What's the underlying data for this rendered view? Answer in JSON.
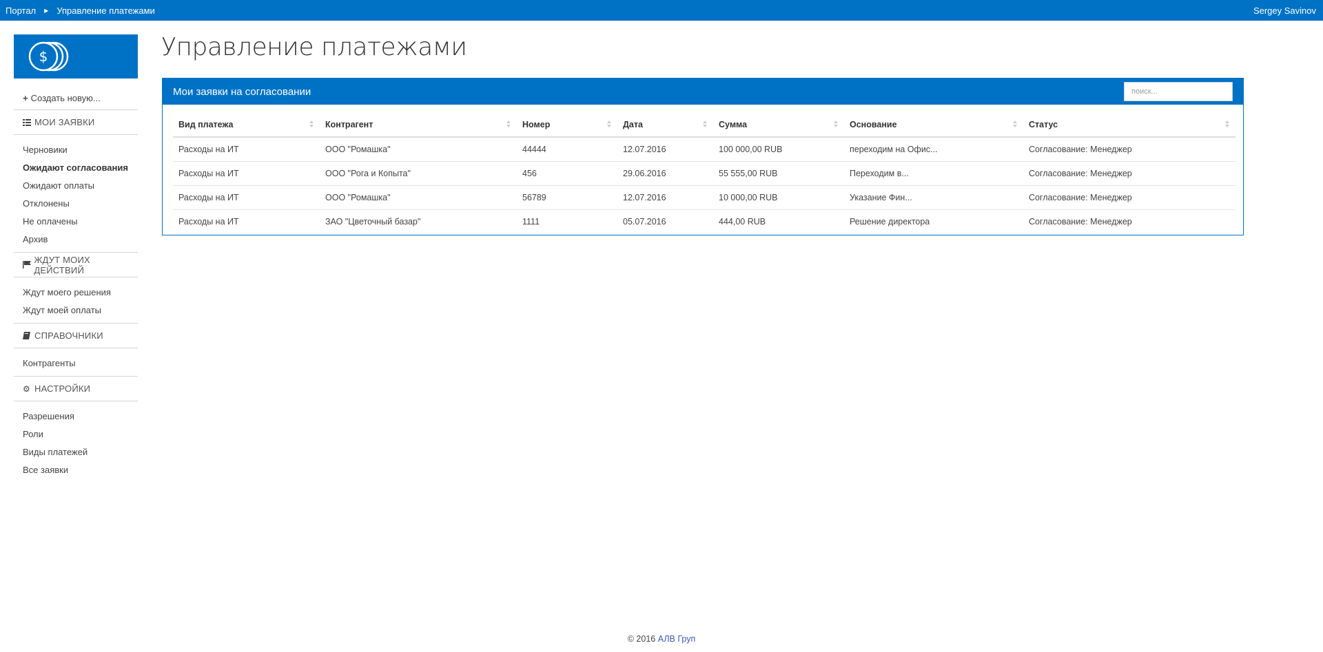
{
  "topbar": {
    "crumbs": [
      "Портал",
      "Управление платежами"
    ],
    "user": "Sergey Savinov"
  },
  "sidebar": {
    "create_label": "Создать новую...",
    "sections": [
      {
        "icon": "list-icon",
        "title": "МОИ ЗАЯВКИ",
        "items": [
          "Черновики",
          "Ожидают согласования",
          "Ожидают оплаты",
          "Отклонены",
          "Не оплачены",
          "Архив"
        ],
        "active": 1
      },
      {
        "icon": "flag-icon",
        "title": "ЖДУТ МОИХ ДЕЙСТВИЙ",
        "items": [
          "Ждут моего решения",
          "Ждут моей оплаты"
        ]
      },
      {
        "icon": "book-icon",
        "title": "СПРАВОЧНИКИ",
        "items": [
          "Контрагенты"
        ]
      },
      {
        "icon": "gear-icon",
        "title": "НАСТРОЙКИ",
        "items": [
          "Разрешения",
          "Роли",
          "Виды платежей",
          "Все заявки"
        ]
      }
    ]
  },
  "main": {
    "title": "Управление платежами",
    "panel_title": "Мои заявки на согласовании",
    "search_placeholder": "поиск...",
    "columns": [
      "Вид платежа",
      "Контрагент",
      "Номер",
      "Дата",
      "Сумма",
      "Основание",
      "Статус"
    ],
    "rows": [
      [
        "Расходы на ИТ",
        "ООО \"Ромашка\"",
        "44444",
        "12.07.2016",
        "100 000,00 RUB",
        "переходим на Офис...",
        "Согласование: Менеджер"
      ],
      [
        "Расходы на ИТ",
        "ООО \"Рога и Копыта\"",
        "456",
        "29.06.2016",
        "55 555,00 RUB",
        "Переходим в...",
        "Согласование: Менеджер"
      ],
      [
        "Расходы на ИТ",
        "ООО \"Ромашка\"",
        "56789",
        "12.07.2016",
        "10 000,00 RUB",
        "Указание Фин...",
        "Согласование: Менеджер"
      ],
      [
        "Расходы на ИТ",
        "ЗАО \"Цветочный базар\"",
        "1111",
        "05.07.2016",
        "444,00 RUB",
        "Решение директора",
        "Согласование: Менеджер"
      ]
    ]
  },
  "footer": {
    "copyright": "© 2016",
    "company": "АЛВ Груп"
  },
  "colors": {
    "brand": "#0072c6"
  }
}
